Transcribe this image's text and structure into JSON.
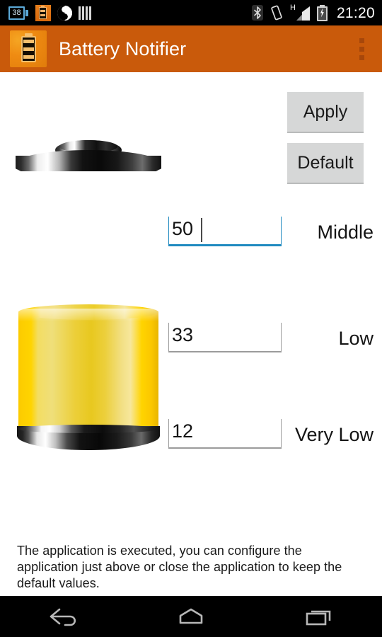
{
  "status_bar": {
    "left_icons": [
      {
        "name": "battery-saver-icon",
        "label": "38"
      },
      {
        "name": "battery-notifier-icon",
        "label": ""
      },
      {
        "name": "sync-glyph-icon",
        "label": ""
      },
      {
        "name": "bars-icon",
        "label": ""
      }
    ],
    "right_icons": [
      {
        "name": "bluetooth-icon",
        "label": ""
      },
      {
        "name": "vibrate-icon",
        "label": ""
      },
      {
        "name": "signal-icon",
        "label": "H"
      },
      {
        "name": "charging-battery-icon",
        "label": ""
      }
    ],
    "clock": "21:20"
  },
  "appbar": {
    "title": "Battery Notifier",
    "icon_name": "app-battery-icon",
    "overflow_name": "overflow-menu-icon",
    "background_color": "#c95a0b"
  },
  "buttons": {
    "apply": "Apply",
    "default": "Default"
  },
  "fields": [
    {
      "id": "middle",
      "value": "50",
      "label": "Middle",
      "focused": true
    },
    {
      "id": "low",
      "value": "33",
      "label": "Low",
      "focused": false
    },
    {
      "id": "verylow",
      "value": "12",
      "label": "Very Low",
      "focused": false
    }
  ],
  "battery_graphic": {
    "name": "battery-level-illustration",
    "fill_color": "#ffd400",
    "empty_color": "#ffffff",
    "cap_color": "#111111",
    "fill_percent": 40
  },
  "status_message": "The application is executed, you can configure the application just above or close the application to keep the default values.",
  "nav_bar": {
    "back": "back-button",
    "home": "home-button",
    "recents": "recents-button"
  },
  "colors": {
    "accent_orange": "#c95a0b",
    "focus_blue": "#1f8ac0",
    "button_grey": "#d6d7d7",
    "battery_yellow": "#ffd400"
  }
}
